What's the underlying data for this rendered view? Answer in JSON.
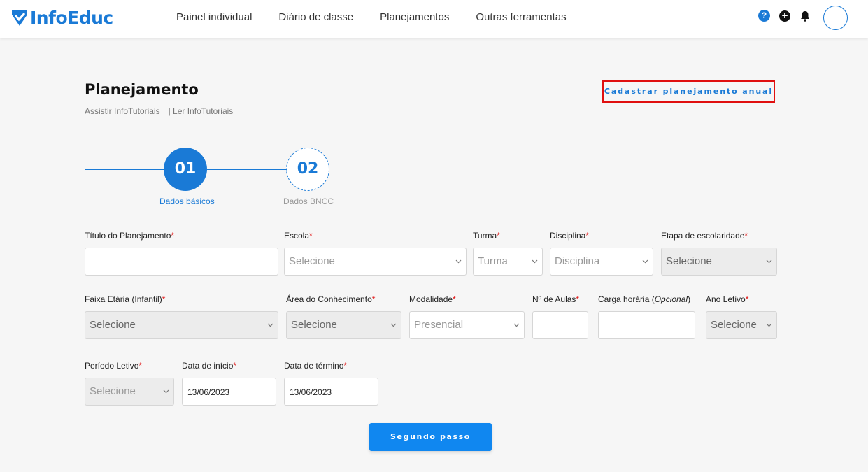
{
  "header": {
    "logo_text": "InfoEduc",
    "nav": [
      "Painel individual",
      "Diário de classe",
      "Planejamentos",
      "Outras ferramentas"
    ],
    "help_glyph": "?",
    "add_glyph": "+",
    "brand_color": "#1a7ad6"
  },
  "page": {
    "title": "Planejamento",
    "tutorial_watch": "Assistir InfoTutoriais",
    "tutorial_read": "| Ler InfoTutoriais",
    "annual_button": "Cadastrar planejamento anual"
  },
  "stepper": {
    "steps": [
      {
        "number": "01",
        "label": "Dados básicos",
        "active": true
      },
      {
        "number": "02",
        "label": "Dados BNCC",
        "active": false
      }
    ]
  },
  "form": {
    "titulo": {
      "label": "Título do Planejamento",
      "value": ""
    },
    "escola": {
      "label": "Escola",
      "value": "Selecione"
    },
    "turma": {
      "label": "Turma",
      "value": "Turma"
    },
    "disciplina": {
      "label": "Disciplina",
      "value": "Disciplina"
    },
    "etapa": {
      "label": "Etapa de escolaridade",
      "value": "Selecione"
    },
    "faixa": {
      "label": "Faixa Etária (Infantil)",
      "value": "Selecione"
    },
    "area": {
      "label": "Área do Conhecimento",
      "value": "Selecione"
    },
    "modalidade": {
      "label": "Modalidade",
      "value": "Presencial"
    },
    "aulas": {
      "label": "Nº de Aulas",
      "value": ""
    },
    "carga": {
      "label": "Carga horária (",
      "label_em": "Opcional",
      "label_end": ")",
      "value": ""
    },
    "ano": {
      "label": "Ano Letivo",
      "value": "Selecione"
    },
    "periodo": {
      "label": "Período Letivo",
      "value": "Selecione"
    },
    "inicio": {
      "label": "Data de início",
      "value": "13/06/2023"
    },
    "termino": {
      "label": "Data de término",
      "value": "13/06/2023"
    },
    "required_mark": "*"
  },
  "next_button": "Segundo passo"
}
